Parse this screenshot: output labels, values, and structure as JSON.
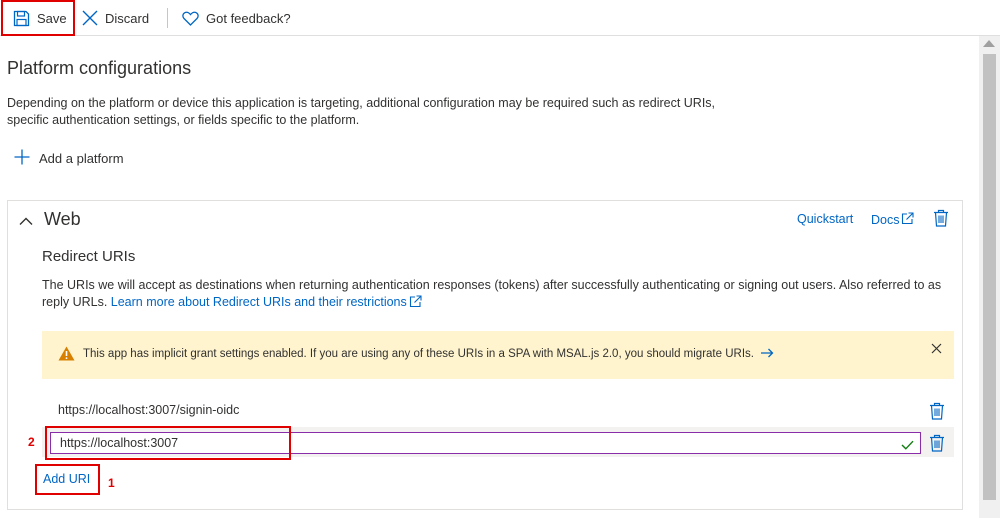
{
  "toolbar": {
    "save_label": "Save",
    "discard_label": "Discard",
    "feedback_label": "Got feedback?"
  },
  "page": {
    "title": "Platform configurations",
    "description": "Depending on the platform or device this application is targeting, additional configuration may be required such as redirect URIs, specific authentication settings, or fields specific to the platform.",
    "add_platform_label": "Add a platform"
  },
  "web_card": {
    "title": "Web",
    "quickstart_label": "Quickstart",
    "docs_label": "Docs",
    "redirect_title": "Redirect URIs",
    "redirect_description": "The URIs we will accept as destinations when returning authentication responses (tokens) after successfully authenticating or signing out users. Also referred to as reply URLs.",
    "learn_more_label": "Learn more about Redirect URIs and their restrictions",
    "warning_text": "This app has implicit grant settings enabled. If you are using any of these URIs in a SPA with MSAL.js 2.0, you should migrate URIs.",
    "redirect_uris": [
      "https://localhost:3007/signin-oidc",
      "https://localhost:3007"
    ],
    "add_uri_label": "Add URI"
  },
  "annotations": {
    "step_1": "1",
    "step_2": "2"
  },
  "colors": {
    "link": "#0066c4",
    "highlight": "#e00000",
    "warning_bg": "#fff4ce",
    "warning_icon": "#d67f00",
    "input_focus_border": "#8a2da8",
    "check": "#107c10"
  },
  "icons": {
    "save": "save-icon",
    "discard": "close-icon",
    "feedback": "heart-icon",
    "add": "plus-icon",
    "collapse": "chevron-up-icon",
    "external": "external-link-icon",
    "delete": "trash-icon",
    "warning": "warning-icon",
    "dismiss": "close-icon",
    "arrow": "arrow-right-icon",
    "valid": "checkmark-icon"
  }
}
